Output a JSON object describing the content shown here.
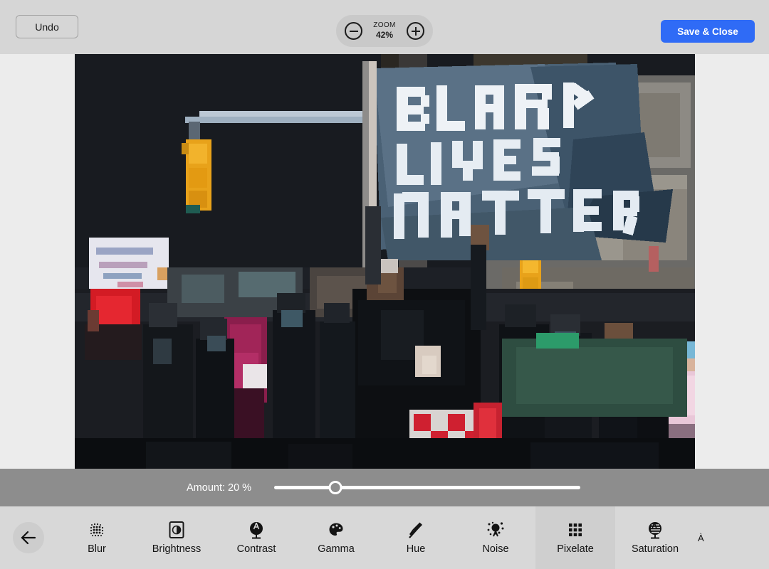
{
  "topbar": {
    "undo_label": "Undo",
    "zoom_label": "ZOOM",
    "zoom_value": "42%",
    "zoom_out_icon": "minus-circle-icon",
    "zoom_in_icon": "plus-circle-icon",
    "save_label": "Save & Close",
    "save_color": "#2f6bf6",
    "background": "#d6d6d6"
  },
  "canvas": {
    "background": "#ececec",
    "image_alt": "Protest crowd with BLACK LIVES MATTER banner, pixelated",
    "banner_text": "BLACK LIVES MATTER"
  },
  "slider": {
    "label": "Amount: 20 %",
    "value": 20,
    "min": 0,
    "max": 100,
    "unit": "%",
    "background": "#8d8d8d",
    "track_color": "#ffffff"
  },
  "filterbar": {
    "background": "#d8d8d8",
    "selected_background": "#cfcfcf",
    "back_icon": "arrow-left-icon",
    "selected": "Pixelate",
    "items": [
      {
        "label": "Blur",
        "icon": "blur-dots-icon",
        "selected": false
      },
      {
        "label": "Brightness",
        "icon": "brightness-square-icon",
        "selected": false
      },
      {
        "label": "Contrast",
        "icon": "contrast-circle-icon",
        "selected": false
      },
      {
        "label": "Gamma",
        "icon": "palette-icon",
        "selected": false
      },
      {
        "label": "Hue",
        "icon": "hue-brush-icon",
        "selected": false
      },
      {
        "label": "Noise",
        "icon": "noise-scatter-icon",
        "selected": false
      },
      {
        "label": "Pixelate",
        "icon": "pixel-grid-icon",
        "selected": true
      },
      {
        "label": "Saturation",
        "icon": "saturation-icon",
        "selected": false
      },
      {
        "label": "À",
        "icon": "clipped-icon",
        "selected": false
      }
    ]
  }
}
